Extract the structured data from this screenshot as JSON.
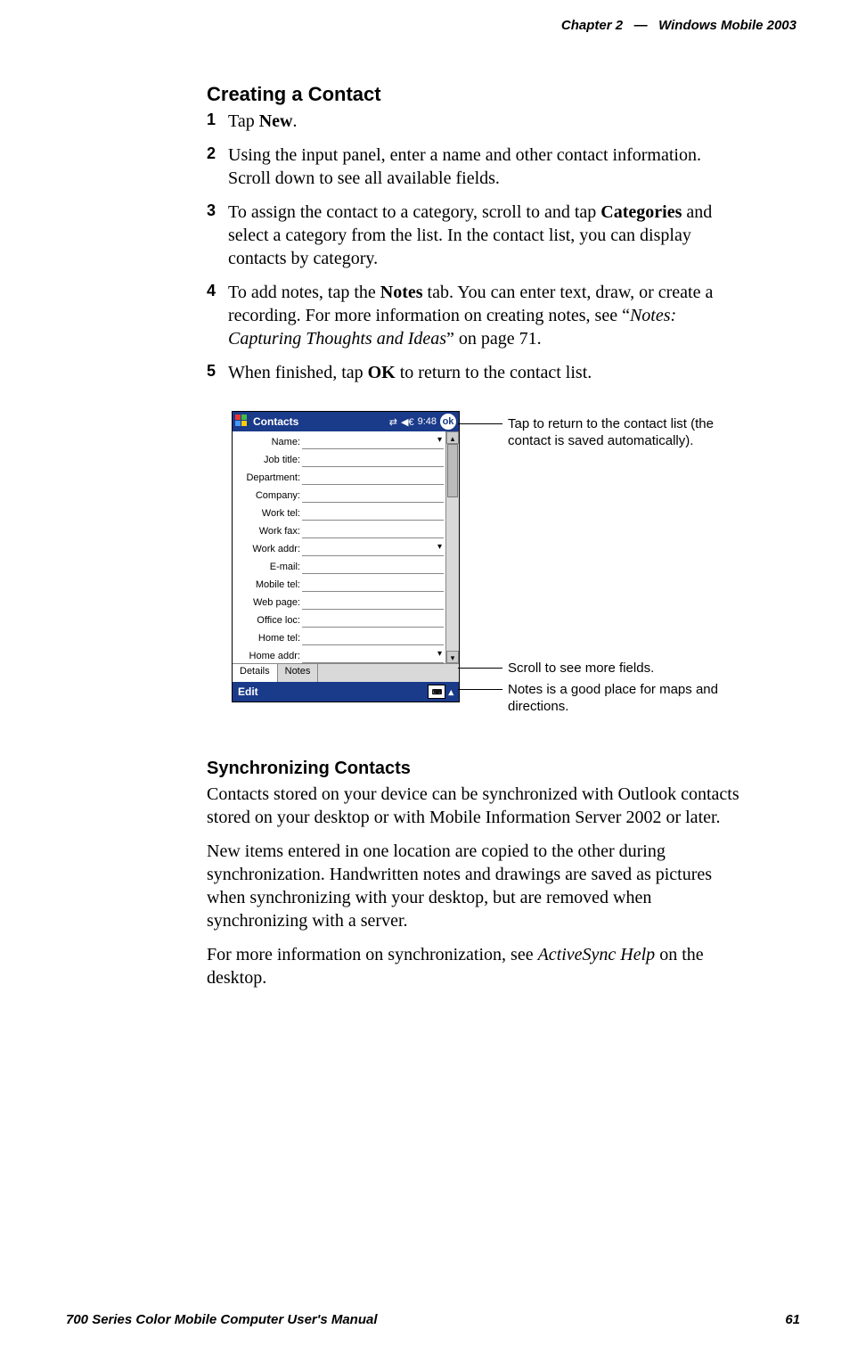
{
  "header": {
    "chapter": "Chapter 2",
    "dash": "—",
    "title": "Windows Mobile 2003"
  },
  "section1": {
    "heading": "Creating a Contact",
    "steps": [
      {
        "n": "1",
        "text": "Tap ",
        "bold": "New",
        "after": "."
      },
      {
        "n": "2",
        "text": "Using the input panel, enter a name and other contact information. Scroll down to see all available fields."
      },
      {
        "n": "3",
        "pre": "To assign the contact to a category, scroll to and tap ",
        "bold": "Categories",
        "post": " and select a category from the list. In the contact list, you can display contacts by category."
      },
      {
        "n": "4",
        "pre": "To add notes, tap the ",
        "bold": "Notes",
        "mid": " tab. You can enter text, draw, or create a recording. For more information on creating notes, see “",
        "ital": "Notes: Capturing Thoughts and Ideas",
        "post": "” on page 71."
      },
      {
        "n": "5",
        "pre": "When finished, tap ",
        "bold": "OK",
        "post": " to return to the contact list."
      }
    ]
  },
  "screenshot": {
    "title": "Contacts",
    "time": "9:48",
    "ok": "ok",
    "fields": [
      {
        "label": "Name:",
        "dropdown": true
      },
      {
        "label": "Job title:"
      },
      {
        "label": "Department:"
      },
      {
        "label": "Company:"
      },
      {
        "label": "Work tel:"
      },
      {
        "label": "Work fax:"
      },
      {
        "label": "Work addr:",
        "dropdown": true
      },
      {
        "label": "E-mail:"
      },
      {
        "label": "Mobile tel:"
      },
      {
        "label": "Web page:"
      },
      {
        "label": "Office loc:"
      },
      {
        "label": "Home tel:"
      },
      {
        "label": "Home addr:",
        "dropdown": true
      }
    ],
    "tabs": {
      "details": "Details",
      "notes": "Notes"
    },
    "edit": "Edit"
  },
  "callouts": {
    "c1": "Tap to return to the contact list (the contact is saved automatically).",
    "c2": "Scroll to see more fields.",
    "c3": "Notes is a good place for maps and directions."
  },
  "section2": {
    "heading": "Synchronizing Contacts",
    "p1": "Contacts stored on your device can be synchronized with Outlook contacts stored on your desktop or with Mobile Information Server 2002 or later.",
    "p2": "New items entered in one location are copied to the other during synchronization. Handwritten notes and drawings are saved as pictures when synchronizing with your desktop, but are removed when synchronizing with a server.",
    "p3_pre": "For more information on synchronization, see ",
    "p3_ital": "ActiveSync Help",
    "p3_post": " on the desktop."
  },
  "footer": {
    "manual": "700 Series Color Mobile Computer User's Manual",
    "page": "61"
  }
}
